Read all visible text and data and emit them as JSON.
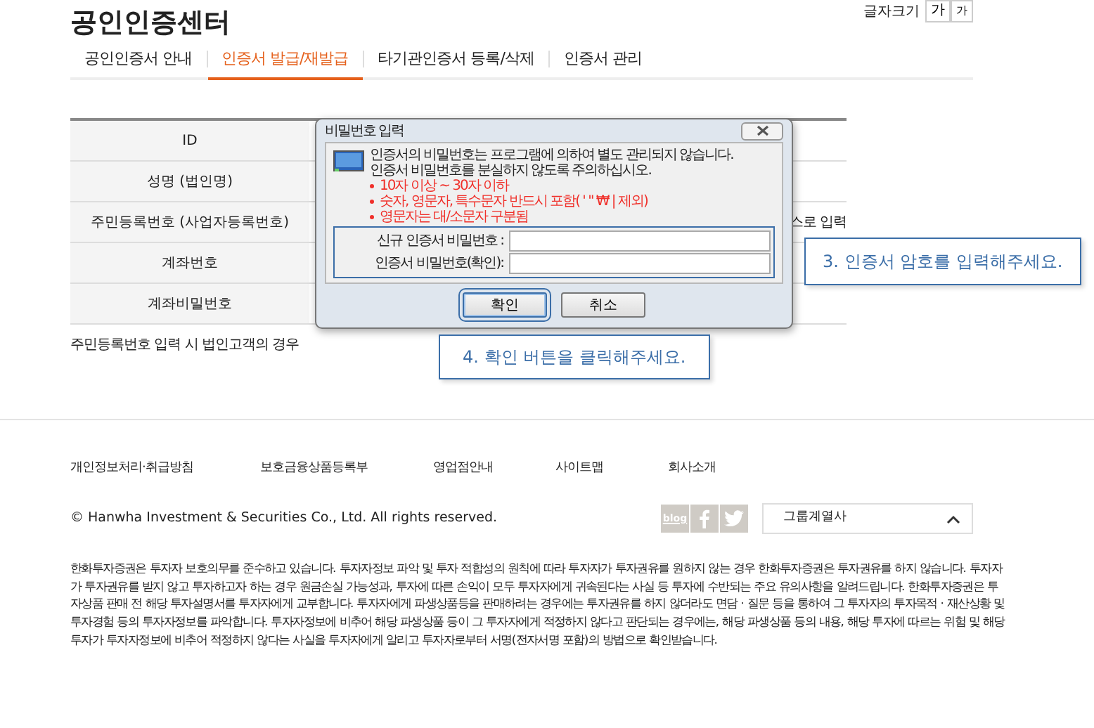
{
  "header": {
    "title": "공인인증센터",
    "font_size_label": "글자크기",
    "font_size_buttons": [
      "가",
      "가"
    ]
  },
  "tabs": [
    {
      "label": "공인인증서 안내",
      "selected": false
    },
    {
      "label": "인증서 발급/재발급",
      "selected": true
    },
    {
      "label": "타기관인증서 등록/삭제",
      "selected": false
    },
    {
      "label": "인증서 관리",
      "selected": false
    }
  ],
  "form_rows": [
    {
      "label": "ID"
    },
    {
      "label": "성명 (법인명)"
    },
    {
      "label": "주민등록번호 (사업자등록번호)",
      "value": "스로 입력"
    },
    {
      "label": "계좌번호"
    },
    {
      "label": "계좌비밀번호"
    }
  ],
  "note": "주민등록번호 입력 시 법인고객의 경우",
  "dialog": {
    "title": "비밀번호 입력",
    "message": [
      "인증서의 비밀번호는 프로그램에 의하여 별도 관리되지 않습니다.",
      "인증서 비밀번호를 분실하지 않도록 주의하십시오."
    ],
    "rules": [
      "10자 이상 ~ 30자 이하",
      "숫자, 영문자, 특수문자 반드시 포함( ' \" ₩ | 제외)",
      "영문자는 대/소문자 구분됨"
    ],
    "fields_highlighted": true,
    "fields": [
      {
        "label": "신규 인증서 비밀번호 :"
      },
      {
        "label": "인증서 비밀번호(확인):"
      }
    ],
    "buttons": [
      {
        "label": "확인",
        "highlighted": true
      },
      {
        "label": "취소",
        "highlighted": false
      }
    ]
  },
  "callouts": [
    {
      "text": "3. 인증서 암호를 입력해주세요."
    },
    {
      "text": "4. 확인 버튼을 클릭해주세요."
    }
  ],
  "footer": {
    "links": [
      "개인정보처리·취급방침",
      "보호금융상품등록부",
      "영업점안내",
      "사이트맵",
      "회사소개"
    ],
    "copyright": "© Hanwha Investment & Securities Co., Ltd. All rights reserved.",
    "social": [
      {
        "kind": "blog",
        "label": "blog"
      },
      {
        "kind": "facebook"
      },
      {
        "kind": "twitter"
      }
    ],
    "group_select": "그룹계열사",
    "disclaimer": "한화투자증권은 투자자 보호의무를 준수하고 있습니다. 투자자정보 파악 및 투자 적합성의 원칙에 따라 투자자가 투자권유를 원하지 않는 경우 한화투자증권은 투자권유를 하지 않습니다. 투자자가 투자권유를 받지 않고 투자하고자 하는 경우 원금손실 가능성과, 투자에 따른 손익이 모두 투자자에게 귀속된다는 사실 등 투자에 수반되는 주요 유의사항을 알려드립니다. 한화투자증권은 투자상품 판매 전 해당 투자설명서를 투자자에게 교부합니다. 투자자에게 파생상품등을 판매하려는 경우에는 투자권유를 하지 않더라도 면담 · 질문 등을 통하여 그 투자자의 투자목적 · 재산상황 및 투자경험 등의 투자자정보를 파악합니다. 투자자정보에 비추어 해당 파생상품 등이 그 투자자에게 적정하지 않다고 판단되는 경우에는, 해당 파생상품 등의 내용, 해당 투자에 따르는 위험 및 해당 투자가 투자자정보에 비추어 적정하지 않다는 사실을 투자자에게 알리고 투자자로부터 서명(전자서명 포함)의 방법으로 확인받습니다."
  }
}
